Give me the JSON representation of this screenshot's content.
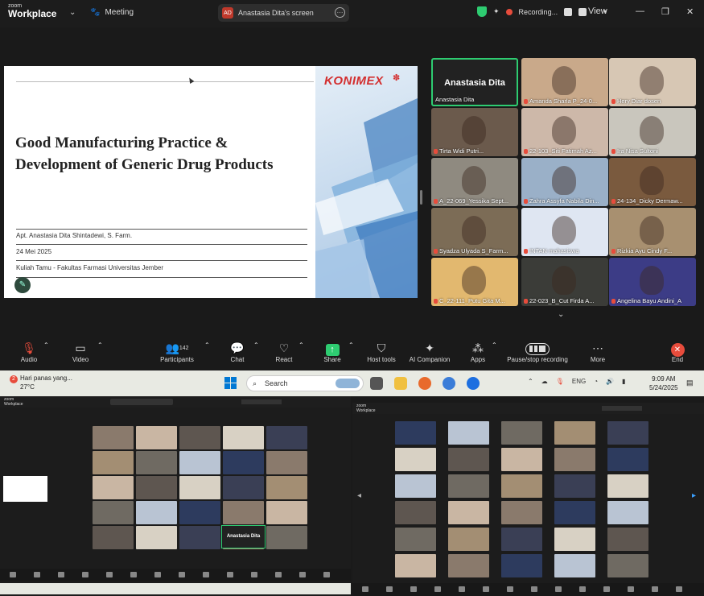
{
  "zoom": {
    "logo_top": "zoom",
    "logo_bottom": "Workplace",
    "meeting_label": "Meeting",
    "screen_share_avatar": "AD",
    "screen_share_label": "Anastasia Dita's screen",
    "recording_label": "Recording...",
    "view_label": "View"
  },
  "slide": {
    "brand": "KONIMEX",
    "title_line1": "Good Manufacturing Practice &",
    "title_line2": "Development of Generic Drug Products",
    "presenter": "Apt. Anastasia Dita Shintadewi, S. Farm.",
    "date": "24 Mei 2025",
    "event": "Kuliah Tamu - Fakultas Farmasi Universitas Jember"
  },
  "gallery": {
    "tiles": [
      {
        "name": "Anastasia Dita",
        "big": "Anastasia Dita",
        "color": "#222222"
      },
      {
        "name": "Amanda Sharla P_24-0...",
        "color": "#c9a98a"
      },
      {
        "name": "Hery Diar dosen",
        "color": "#d7c7b4"
      },
      {
        "name": "Tirta Widi Putri...",
        "color": "#6b5a4c"
      },
      {
        "name": "22-103_Siti Fatimah Az...",
        "color": "#cdb8a9"
      },
      {
        "name": "Ira Nisa Sultoni",
        "color": "#c9c6bd"
      },
      {
        "name": "A_22-069_Yessika Sept...",
        "color": "#8f8a80"
      },
      {
        "name": "Zahra Assyfa Nabila Din...",
        "color": "#9ab0c8"
      },
      {
        "name": "24-134_Dicky Dermaw...",
        "color": "#7a5a3e"
      },
      {
        "name": "Syadza Ulyada S_Farm...",
        "color": "#7c6c56"
      },
      {
        "name": "INTAN mahasiswa",
        "color": "#dfe6f2"
      },
      {
        "name": "Rizkia Ayu Cindy F...",
        "color": "#a89070"
      },
      {
        "name": "C_22-111_Putu Gita M...",
        "color": "#e2b86f"
      },
      {
        "name": "22-023_B_Cut Firda A...",
        "color": "#3b3c38"
      },
      {
        "name": "Angelina Bayu Andini_A",
        "color": "#3c3c86"
      }
    ]
  },
  "toolbar": {
    "audio": "Audio",
    "video": "Video",
    "participants": "Participants",
    "participants_count": "142",
    "chat": "Chat",
    "react": "React",
    "share": "Share",
    "host_tools": "Host tools",
    "ai_companion": "AI Companion",
    "apps": "Apps",
    "pause_recording": "Pause/stop recording",
    "more": "More",
    "end": "End"
  },
  "taskbar": {
    "weather_badge": "2",
    "weather_text": "Hari panas yang...",
    "temperature": "27°C",
    "search_placeholder": "Search",
    "language": "ENG",
    "time": "9:09 AM",
    "date": "5/24/2025"
  },
  "lower_left": {
    "speaker_name": "Anastasia Dita"
  },
  "colors": {
    "accent_green": "#2ecc71",
    "end_red": "#e74c3c",
    "brand_red": "#d32f2f"
  }
}
